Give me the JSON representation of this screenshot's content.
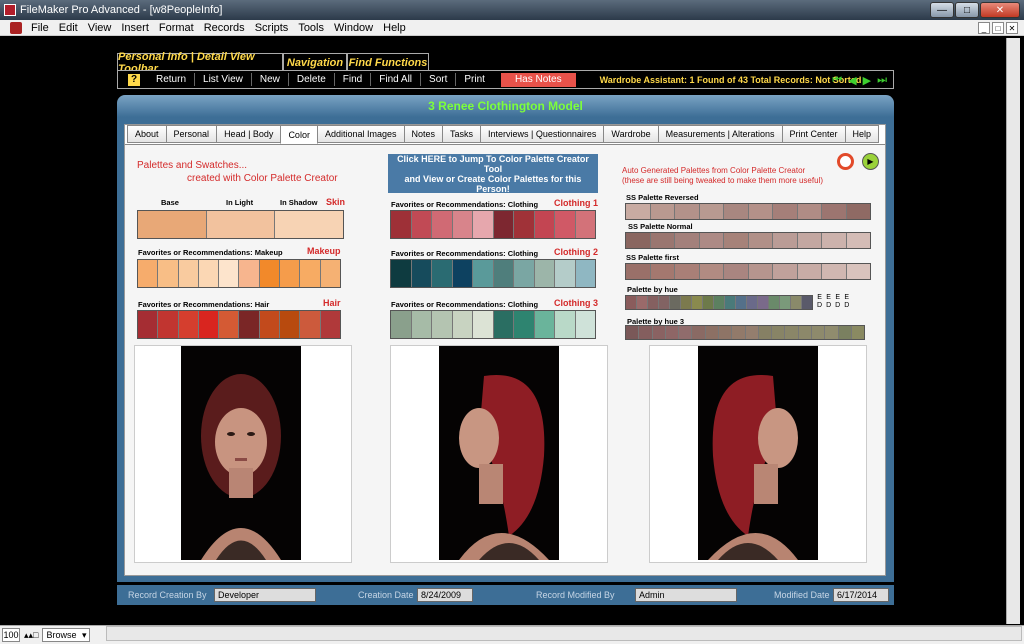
{
  "window": {
    "title": "FileMaker Pro Advanced - [w8PeopleInfo]"
  },
  "menu": [
    "File",
    "Edit",
    "View",
    "Insert",
    "Format",
    "Records",
    "Scripts",
    "Tools",
    "Window",
    "Help"
  ],
  "toolbar_tabs": [
    "Personal Info | Detail View Toolbar",
    "Navigation",
    "Find Functions"
  ],
  "toolbar": {
    "help": "?",
    "buttons": [
      "Return",
      "List View",
      "New",
      "Delete",
      "Find",
      "Find All",
      "Sort",
      "Print"
    ],
    "has_notes": "Has Notes",
    "wardrobe": "Wardrobe Assistant:  1 Found of 43 Total Records: Not Sorted"
  },
  "record": {
    "header": "3    Renee Clothington    Model"
  },
  "tabs": [
    "About",
    "Personal",
    "Head | Body",
    "Color",
    "Additional Images",
    "Notes",
    "Tasks",
    "Interviews | Questionnaires",
    "Wardrobe",
    "Measurements | Alterations",
    "Print Center",
    "Help"
  ],
  "active_tab": "Color",
  "left": {
    "heading1": "Palettes and Swatches...",
    "heading2": "created with Color Palette Creator",
    "skin": {
      "cols": [
        "Base",
        "In Light",
        "In Shadow"
      ],
      "label": "Skin",
      "colors": [
        "#e8a877",
        "#f2c29e",
        "#f7d3b4"
      ]
    },
    "makeup": {
      "title": "Favorites or Recommendations: Makeup",
      "label": "Makeup",
      "colors": [
        "#f6ac6c",
        "#f8be86",
        "#f9cb9f",
        "#fbd7b4",
        "#fde4cc",
        "#f7b58e",
        "#f2892a",
        "#f59c4b",
        "#f7ab63",
        "#f5b173"
      ]
    },
    "hair": {
      "title": "Favorites or Recommendations:  Hair",
      "label": "Hair",
      "colors": [
        "#a52d33",
        "#c13530",
        "#d53e2e",
        "#d9251f",
        "#d45a34",
        "#7a2626",
        "#c24a1c",
        "#b84a0e",
        "#cc5a3c",
        "#b0393a"
      ]
    }
  },
  "mid": {
    "jump1": "Click HERE to Jump To Color Palette Creator Tool",
    "jump2": "and View or Create  Color Palettes for this Person!",
    "c1": {
      "title": "Favorites or Recommendations: Clothing",
      "label": "Clothing 1",
      "colors": [
        "#9e3037",
        "#c14a55",
        "#d06a74",
        "#d8848b",
        "#e6a7ad",
        "#7d2730",
        "#a03238",
        "#c34552",
        "#d05966",
        "#d37279"
      ]
    },
    "c2": {
      "title": "Favorites or Recommendations: Clothing",
      "label": "Clothing 2",
      "colors": [
        "#0e3b40",
        "#164b5c",
        "#2a6b72",
        "#0d4160",
        "#5a9a9a",
        "#4f7e7c",
        "#7aa6a3",
        "#9cb5a9",
        "#b4ccc9",
        "#8fb7c2"
      ]
    },
    "c3": {
      "title": "Favorites or Recommendations:  Clothing",
      "label": "Clothing 3",
      "colors": [
        "#8aa08c",
        "#a6bba7",
        "#b4c4b1",
        "#c8d3c1",
        "#dce3d5",
        "#2a6e62",
        "#2e8470",
        "#6ab49b",
        "#b9d9c8",
        "#cfe2d9"
      ]
    }
  },
  "right": {
    "note1": "Auto Generated Palettes from Color Palette Creator",
    "note2": "(these are still being tweaked to make them more useful)",
    "rows": [
      {
        "name": "SS Palette Reversed",
        "colors": [
          "#c8aba2",
          "#b99990",
          "#b3928a",
          "#b89a91",
          "#a88780",
          "#b49189",
          "#a57f79",
          "#b08c85",
          "#9c7570",
          "#8f6a64"
        ]
      },
      {
        "name": "SS Palette Normal",
        "colors": [
          "#8a6660",
          "#9a7670",
          "#a3807b",
          "#ad8a85",
          "#a68279",
          "#b19088",
          "#ba9c96",
          "#c3a7a1",
          "#ccb2ac",
          "#d4bcb6"
        ]
      },
      {
        "name": "SS Palette first",
        "colors": [
          "#9a7069",
          "#a4786f",
          "#a97f77",
          "#b18b82",
          "#a98580",
          "#b6958e",
          "#c0a19b",
          "#c8aca6",
          "#d0b7b1",
          "#d9c3bd"
        ]
      },
      {
        "name": "Palette by hue",
        "colors": [
          "#8a5c5c",
          "#9a6a6a",
          "#856060",
          "#826363",
          "#6b6a60",
          "#7c7a4e",
          "#8a8a4e",
          "#6d7a4a",
          "#5c8060",
          "#4a7a7a",
          "#54708a",
          "#6a6a8a",
          "#7a6a8a",
          "#6a8a6a",
          "#7a9a7a",
          "#8a8a6a",
          "#5a5a6a"
        ]
      },
      {
        "name": "Palette by hue 3",
        "colors": [
          "#7a5858",
          "#845e5e",
          "#8a6262",
          "#8e6666",
          "#906c6c",
          "#8a6a64",
          "#8c7064",
          "#8e7466",
          "#927a6a",
          "#947e6e",
          "#868064",
          "#888466",
          "#8a8668",
          "#8c886a",
          "#8e8a6c",
          "#908c6e",
          "#7a8060",
          "#8a8a62"
        ]
      }
    ],
    "e_marks": [
      "E",
      "E",
      "E",
      "E"
    ],
    "d_marks": [
      "D",
      "D",
      "D",
      "D"
    ]
  },
  "footer": {
    "creation_by_label": "Record Creation By",
    "creation_by": "Developer",
    "creation_date_label": "Creation Date",
    "creation_date": "8/24/2009",
    "modified_by_label": "Record Modified By",
    "modified_by": "Admin",
    "modified_date_label": "Modified Date",
    "modified_date": "6/17/2014"
  },
  "status": {
    "zoom": "100",
    "mode": "Browse"
  }
}
